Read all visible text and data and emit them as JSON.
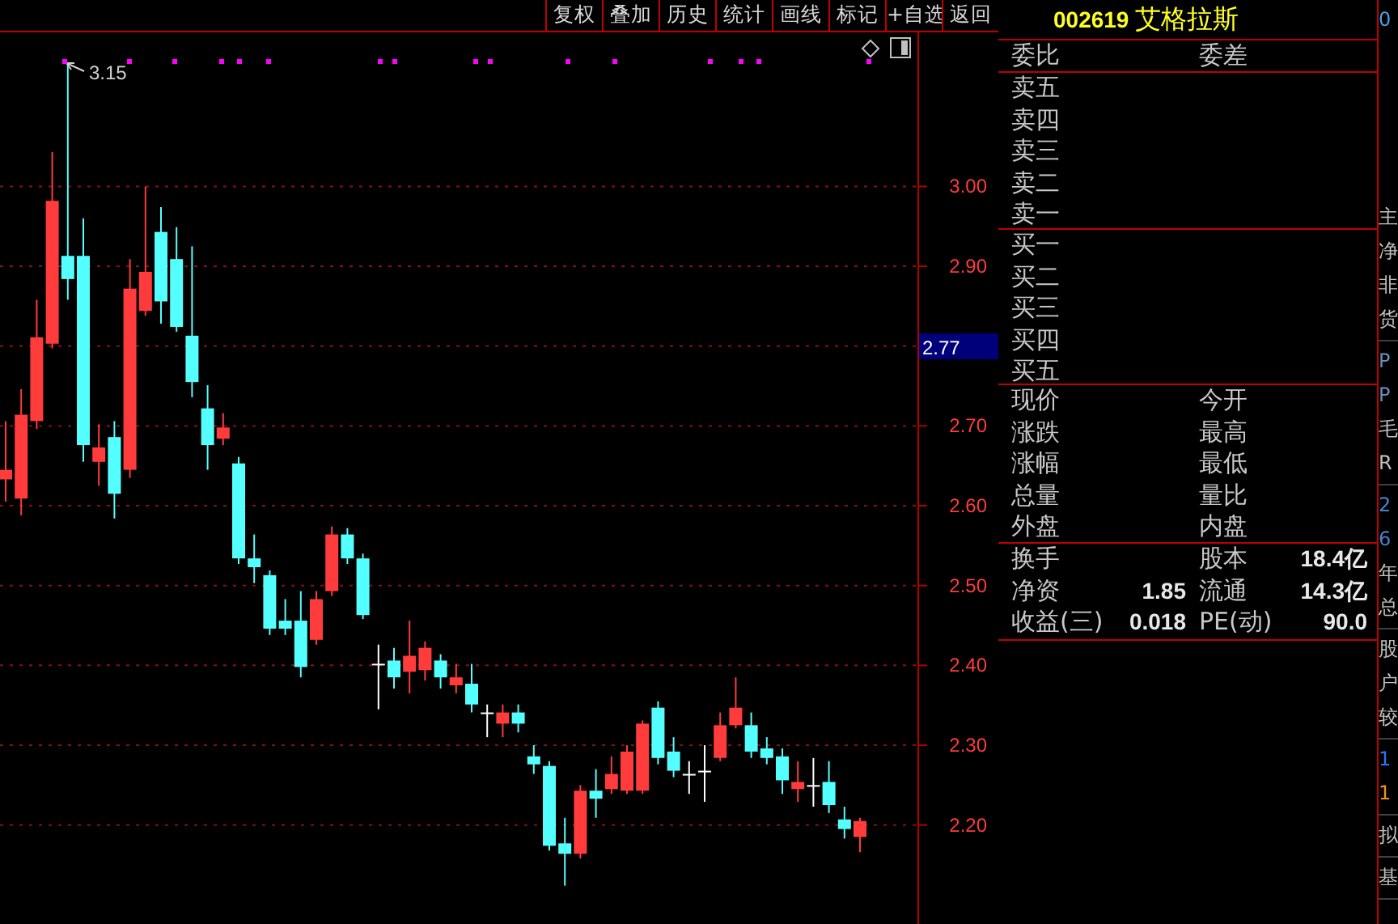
{
  "toolbar": [
    "复权",
    "叠加",
    "历史",
    "统计",
    "画线",
    "标记",
    "+自选",
    "返回"
  ],
  "chart": {
    "current_price": "2.77",
    "high_marker": "3.15",
    "chart_data": {
      "type": "candlestick",
      "ylim": [
        2.076,
        3.193
      ],
      "grid": true,
      "yticks": [
        {
          "value": 3.0,
          "label": "3.00"
        },
        {
          "value": 2.9,
          "label": "2.90"
        },
        {
          "value": 2.7,
          "label": "2.70"
        },
        {
          "value": 2.6,
          "label": "2.60"
        },
        {
          "value": 2.5,
          "label": "2.50"
        },
        {
          "value": 2.4,
          "label": "2.40"
        },
        {
          "value": 2.3,
          "label": "2.30"
        },
        {
          "value": 2.2,
          "label": "2.20"
        }
      ],
      "ohlc": [
        [
          2.633,
          2.706,
          2.605,
          2.645
        ],
        [
          2.609,
          2.746,
          2.588,
          2.714
        ],
        [
          2.706,
          2.858,
          2.696,
          2.811
        ],
        [
          2.803,
          3.043,
          2.797,
          2.982
        ],
        [
          2.913,
          3.152,
          2.858,
          2.884
        ],
        [
          2.913,
          2.96,
          2.655,
          2.676
        ],
        [
          2.655,
          2.702,
          2.625,
          2.673
        ],
        [
          2.686,
          2.706,
          2.584,
          2.615
        ],
        [
          2.645,
          2.909,
          2.635,
          2.872
        ],
        [
          2.844,
          3.0,
          2.838,
          2.893
        ],
        [
          2.943,
          2.974,
          2.828,
          2.856
        ],
        [
          2.909,
          2.949,
          2.818,
          2.824
        ],
        [
          2.813,
          2.925,
          2.736,
          2.755
        ],
        [
          2.722,
          2.751,
          2.645,
          2.676
        ],
        [
          2.684,
          2.716,
          2.676,
          2.698
        ],
        [
          2.653,
          2.661,
          2.527,
          2.534
        ],
        [
          2.534,
          2.564,
          2.503,
          2.523
        ],
        [
          2.513,
          2.519,
          2.438,
          2.446
        ],
        [
          2.456,
          2.483,
          2.438,
          2.446
        ],
        [
          2.456,
          2.493,
          2.385,
          2.398
        ],
        [
          2.432,
          2.493,
          2.426,
          2.483
        ],
        [
          2.493,
          2.574,
          2.487,
          2.564
        ],
        [
          2.564,
          2.572,
          2.527,
          2.534
        ],
        [
          2.534,
          2.54,
          2.458,
          2.463
        ],
        [
          2.402,
          2.426,
          2.345,
          2.402
        ],
        [
          2.406,
          2.422,
          2.371,
          2.385
        ],
        [
          2.392,
          2.456,
          2.365,
          2.412
        ],
        [
          2.394,
          2.43,
          2.381,
          2.422
        ],
        [
          2.406,
          2.414,
          2.371,
          2.385
        ],
        [
          2.375,
          2.402,
          2.365,
          2.385
        ],
        [
          2.377,
          2.402,
          2.341,
          2.351
        ],
        [
          2.341,
          2.351,
          2.31,
          2.341
        ],
        [
          2.327,
          2.351,
          2.31,
          2.341
        ],
        [
          2.341,
          2.351,
          2.316,
          2.327
        ],
        [
          2.286,
          2.3,
          2.264,
          2.276
        ],
        [
          2.274,
          2.28,
          2.168,
          2.174
        ],
        [
          2.177,
          2.209,
          2.124,
          2.164
        ],
        [
          2.164,
          2.25,
          2.158,
          2.243
        ],
        [
          2.243,
          2.27,
          2.209,
          2.233
        ],
        [
          2.245,
          2.286,
          2.239,
          2.264
        ],
        [
          2.243,
          2.3,
          2.239,
          2.292
        ],
        [
          2.243,
          2.331,
          2.239,
          2.327
        ],
        [
          2.347,
          2.355,
          2.276,
          2.284
        ],
        [
          2.292,
          2.31,
          2.26,
          2.268
        ],
        [
          2.264,
          2.28,
          2.239,
          2.264
        ],
        [
          2.268,
          2.3,
          2.229,
          2.268
        ],
        [
          2.284,
          2.341,
          2.28,
          2.325
        ],
        [
          2.325,
          2.385,
          2.321,
          2.347
        ],
        [
          2.325,
          2.341,
          2.284,
          2.292
        ],
        [
          2.296,
          2.31,
          2.276,
          2.284
        ],
        [
          2.286,
          2.296,
          2.239,
          2.256
        ],
        [
          2.245,
          2.28,
          2.229,
          2.254
        ],
        [
          2.25,
          2.284,
          2.223,
          2.25
        ],
        [
          2.254,
          2.28,
          2.215,
          2.225
        ],
        [
          2.207,
          2.223,
          2.183,
          2.195
        ],
        [
          2.185,
          2.209,
          2.166,
          2.205
        ]
      ]
    }
  },
  "quote_panel": {
    "code": "002619",
    "name": "艾格拉斯",
    "order_ratio": {
      "label": "委比",
      "label2": "委差"
    },
    "asks": [
      "卖五",
      "卖四",
      "卖三",
      "卖二",
      "卖一"
    ],
    "bids": [
      "买一",
      "买二",
      "买三",
      "买四",
      "买五"
    ],
    "stats": [
      {
        "label": "现价",
        "label2": "今开"
      },
      {
        "label": "涨跌",
        "label2": "最高"
      },
      {
        "label": "涨幅",
        "label2": "最低"
      },
      {
        "label": "总量",
        "label2": "量比"
      },
      {
        "label": "外盘",
        "label2": "内盘"
      }
    ],
    "fundamentals": [
      {
        "label": "换手",
        "label2": "股本",
        "value2": "18.4亿"
      },
      {
        "label": "净资",
        "value": "1.85",
        "label2": "流通",
        "value2": "14.3亿"
      },
      {
        "label": "收益(三)",
        "value": "0.018",
        "label2": "PE(动)",
        "value2": "90.0"
      }
    ]
  },
  "side_strip": [
    [
      {
        "text": "0",
        "color": "#4aa0e0"
      }
    ],
    [
      {
        "text": "主",
        "color": "#c0c0c0"
      },
      {
        "text": "净",
        "color": "#c0c0c0"
      },
      {
        "text": "非",
        "color": "#c0c0c0"
      },
      {
        "text": "货",
        "color": "#c0c0c0"
      }
    ],
    [
      {
        "text": "P",
        "color": "#6a8fb8"
      },
      {
        "text": "P",
        "color": "#6a8fb8"
      },
      {
        "text": "毛",
        "color": "#c0c0c0"
      },
      {
        "text": "R",
        "color": "#c0c0c0"
      }
    ],
    [
      {
        "text": "2",
        "color": "#4a80d0"
      },
      {
        "text": "6",
        "color": "#4a80d0"
      },
      {
        "text": "年",
        "color": "#c0c0c0"
      },
      {
        "text": "总",
        "color": "#c0c0c0"
      }
    ],
    [
      {
        "text": "股",
        "color": "#c0c0c0"
      },
      {
        "text": "户",
        "color": "#c0c0c0"
      },
      {
        "text": "较",
        "color": "#c0c0c0"
      }
    ],
    [
      {
        "text": "1",
        "color": "#3070ff"
      },
      {
        "text": "1",
        "color": "#f09020"
      }
    ],
    [
      {
        "text": "拟",
        "color": "#c0c0c0"
      }
    ],
    [
      {
        "text": "基",
        "color": "#c0c0c0"
      }
    ]
  ]
}
